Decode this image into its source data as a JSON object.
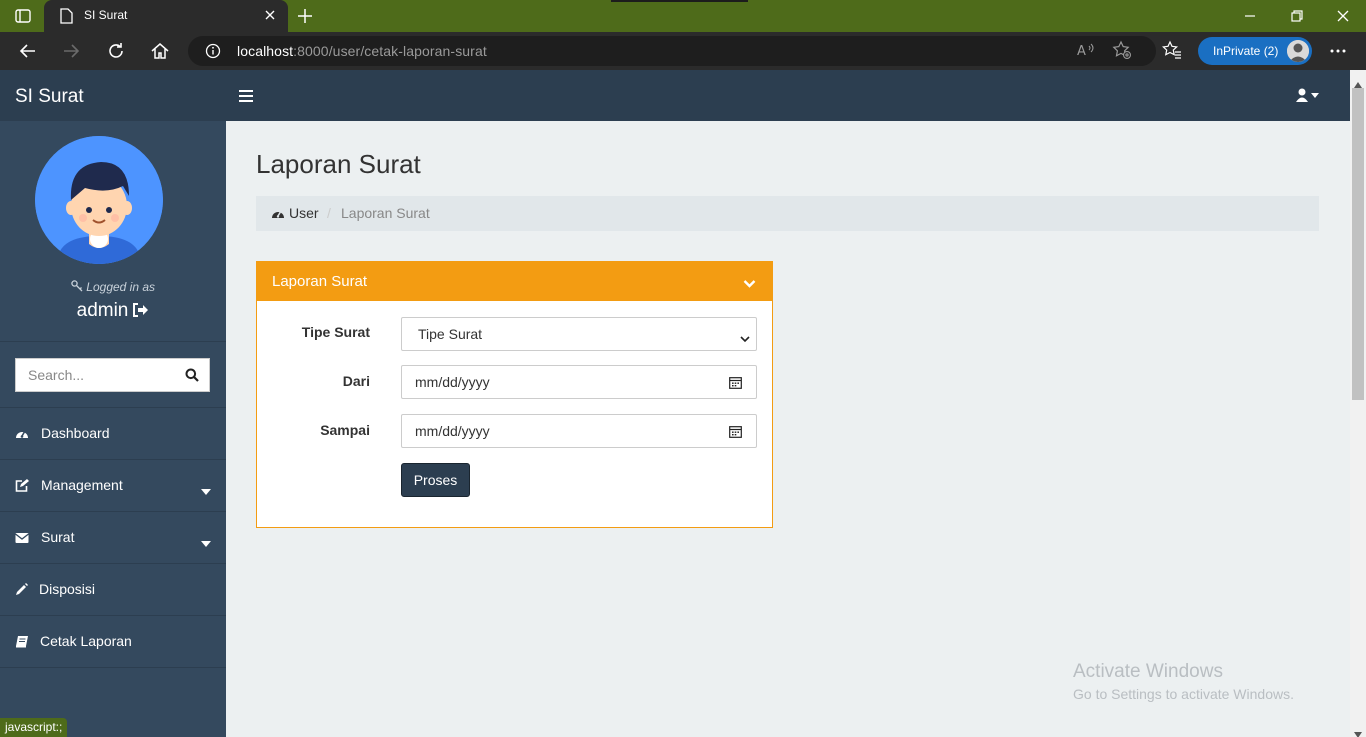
{
  "browser": {
    "tab_title": "SI Surat",
    "url_host": "localhost",
    "url_path": ":8000/user/cetak-laporan-surat",
    "inprivate_label": "InPrivate (2)"
  },
  "app": {
    "brand": "SI Surat",
    "logged_in_label": "Logged in as",
    "username": "admin",
    "search_placeholder": "Search...",
    "menu": [
      {
        "label": "Dashboard",
        "icon": "dashboard-icon",
        "has_caret": false
      },
      {
        "label": "Management",
        "icon": "edit-icon",
        "has_caret": true
      },
      {
        "label": "Surat",
        "icon": "envelope-icon",
        "has_caret": true
      },
      {
        "label": "Disposisi",
        "icon": "pencil-icon",
        "has_caret": false
      },
      {
        "label": "Cetak Laporan",
        "icon": "book-icon",
        "has_caret": false
      }
    ]
  },
  "page": {
    "title": "Laporan Surat",
    "breadcrumb": [
      "User",
      "Laporan Surat"
    ],
    "panel": {
      "title": "Laporan Surat",
      "fields": {
        "tipe_label": "Tipe Surat",
        "tipe_value": "Tipe Surat",
        "dari_label": "Dari",
        "dari_value": "mm/dd/yyyy",
        "sampai_label": "Sampai",
        "sampai_value": "mm/dd/yyyy"
      },
      "submit_label": "Proses"
    }
  },
  "watermark": {
    "line1": "Activate Windows",
    "line2": "Go to Settings to activate Windows."
  },
  "statusbar": "javascript:;",
  "colors": {
    "sidebar": "#34495e",
    "navbar": "#2c3e50",
    "panel_accent": "#f39c12",
    "button": "#2c3e50",
    "browser_frame": "#4e6b1a"
  }
}
